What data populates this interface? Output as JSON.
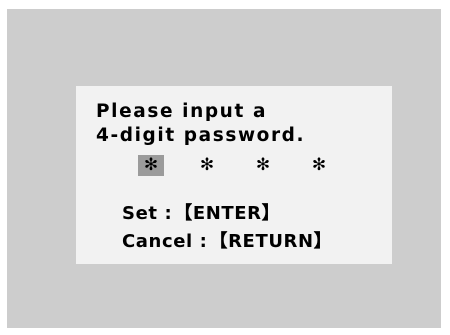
{
  "dialog": {
    "prompt_line_1": "Please input a",
    "prompt_line_2": "4-digit password."
  },
  "password": {
    "digits": [
      "✻",
      "✻",
      "✻",
      "✻"
    ],
    "active_index": 0
  },
  "actions": {
    "set_label": "Set :",
    "set_key": "【ENTER】",
    "cancel_label": "Cancel :",
    "cancel_key": "【RETURN】"
  }
}
